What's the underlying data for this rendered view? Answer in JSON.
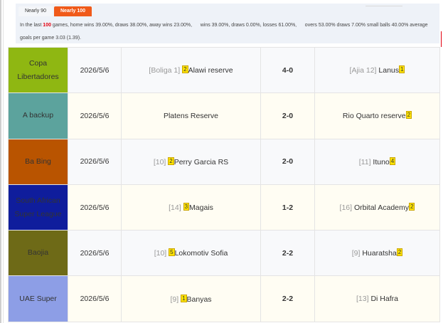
{
  "tabs": [
    {
      "label": "Nearly 90",
      "active": false
    },
    {
      "label": "Nearly 100",
      "active": true
    }
  ],
  "summary": {
    "prefix": "In the last ",
    "count": "100",
    "text1": " games, home wins 39.00%, draws 38.00%, away wins 23.00%,",
    "text2": "wins 39.00%, draws 0.00%, losses 61.00%,",
    "text3": "overs 53.00% draws 7.00% small balls 40.00% average goals per game 3.03 (1.39)."
  },
  "colors": {
    "active_tab": "#f05a1a",
    "score": "#e4000f",
    "badge": "#ffe400"
  },
  "matches": [
    {
      "league": "Copa Libertadores",
      "league_color": "#8fb712",
      "date": "2026/5/6",
      "home_rank": "[Boliga 1]",
      "home_badge": "2",
      "home": "Alawi reserve",
      "score": "4-0",
      "away_rank": "[Ajia 12]",
      "away": "Lanus",
      "away_badge": "1"
    },
    {
      "league": "A backup",
      "league_color": "#5ca39d",
      "date": "2026/5/6",
      "home_rank": "",
      "home_badge": "",
      "home": "Platens Reserve",
      "score": "2-0",
      "away_rank": "",
      "away": "Rio Quarto reserve",
      "away_badge": "2"
    },
    {
      "league": "Ba Bing",
      "league_color": "#b95400",
      "date": "2026/5/6",
      "home_rank": "[10]",
      "home_badge": "2",
      "home": "Perry Garcia RS",
      "score": "2-0",
      "away_rank": "[11]",
      "away": "Ituno",
      "away_badge": "4"
    },
    {
      "league": "South African Super League",
      "league_color": "#0f1d9c",
      "date": "2026/5/6",
      "home_rank": "[14]",
      "home_badge": "3",
      "home": "Magais",
      "score": "1-2",
      "away_rank": "[16]",
      "away": "Orbital Academy",
      "away_badge": "2"
    },
    {
      "league": "Baojia",
      "league_color": "#6e6a17",
      "date": "2026/5/6",
      "home_rank": "[10]",
      "home_badge": "5",
      "home": "Lokomotiv Sofia",
      "score": "2-2",
      "away_rank": "[9]",
      "away": "Huaratsha",
      "away_badge": "2"
    },
    {
      "league": "UAE Super",
      "league_color": "#8d9ee6",
      "date": "2026/5/6",
      "home_rank": "[9]",
      "home_badge": "1",
      "home": "Banyas",
      "score": "2-2",
      "away_rank": "[13]",
      "away": "Di Hafra",
      "away_badge": ""
    }
  ]
}
